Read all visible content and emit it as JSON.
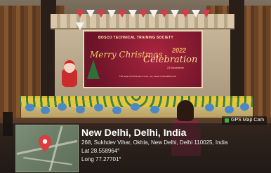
{
  "banner": {
    "org": "BOSCO TECHNICAL TRAINING SOCIETY",
    "merry": "Merry Christmas",
    "year": "2022",
    "celebration": "Celebration",
    "date": "23 December",
    "subtitle": "\"The Hope of Christmas is Love, Joy, Peace & Goodwill to All\""
  },
  "geo": {
    "app_label": "GPS Map Cam",
    "city": "New Delhi, Delhi, India",
    "address": "268, Sukhdev Vihar, Okhla, New Delhi, Delhi 110025, India",
    "lat": "Lat 28.558964°",
    "long": "Long 77.27701°"
  },
  "colors": {
    "banner_red": "#8a1c34",
    "pin_red": "#e0393e",
    "gps_green": "#3bb34a"
  },
  "icons": [
    "map-pin-icon",
    "camera-icon"
  ]
}
